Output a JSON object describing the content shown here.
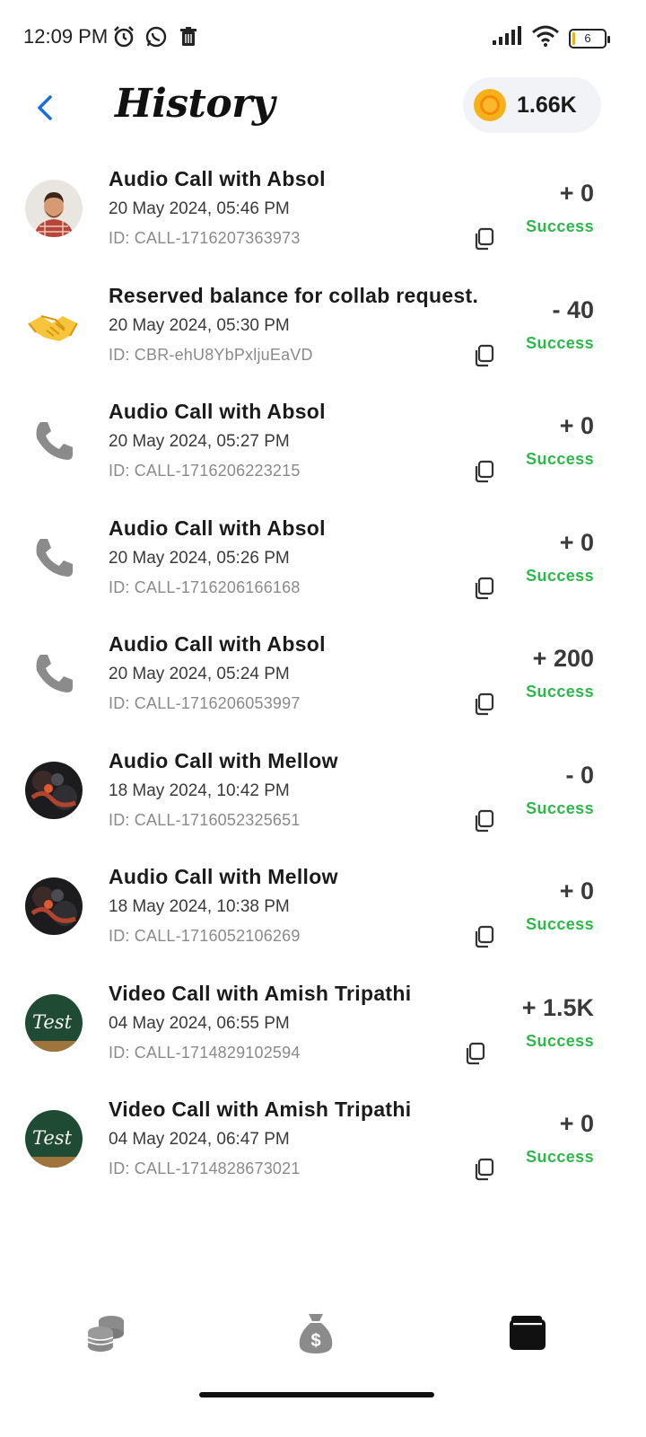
{
  "status_bar": {
    "time": "12:09 PM",
    "battery_level": "6",
    "icons": [
      "alarm-icon",
      "whatsapp-icon",
      "trash-icon",
      "signal-icon",
      "wifi-icon",
      "battery-icon"
    ]
  },
  "header": {
    "title": "History",
    "coin_balance": "1.66K",
    "accent_color": "#1a6fe0"
  },
  "transactions": [
    {
      "title": "Audio Call with Absol",
      "date": "20 May 2024, 05:46 PM",
      "id": "ID: CALL-1716207363973",
      "amount": "+ 0",
      "status": "Success",
      "avatar": "avatar-photo-man"
    },
    {
      "title": "Reserved balance for collab request.",
      "date": "20 May 2024, 05:30 PM",
      "id": "ID: CBR-ehU8YbPxljuEaVD",
      "amount": "- 40",
      "status": "Success",
      "avatar": "handshake-icon"
    },
    {
      "title": "Audio Call with Absol",
      "date": "20 May 2024, 05:27 PM",
      "id": "ID: CALL-1716206223215",
      "amount": "+ 0",
      "status": "Success",
      "avatar": "phone-icon"
    },
    {
      "title": "Audio Call with Absol",
      "date": "20 May 2024, 05:26 PM",
      "id": "ID: CALL-1716206166168",
      "amount": "+ 0",
      "status": "Success",
      "avatar": "phone-icon"
    },
    {
      "title": "Audio Call with Absol",
      "date": "20 May 2024, 05:24 PM",
      "id": "ID: CALL-1716206053997",
      "amount": "+ 200",
      "status": "Success",
      "avatar": "phone-icon"
    },
    {
      "title": "Audio Call with Mellow",
      "date": "18 May 2024, 10:42 PM",
      "id": "ID: CALL-1716052325651",
      "amount": "- 0",
      "status": "Success",
      "avatar": "avatar-photo-dark"
    },
    {
      "title": "Audio Call with Mellow",
      "date": "18 May 2024, 10:38 PM",
      "id": "ID: CALL-1716052106269",
      "amount": "+ 0",
      "status": "Success",
      "avatar": "avatar-photo-dark"
    },
    {
      "title": "Video Call with Amish Tripathi",
      "date": "04 May 2024, 06:55 PM",
      "id": "ID: CALL-1714829102594",
      "amount": "+ 1.5K",
      "status": "Success",
      "avatar": "avatar-test-board"
    },
    {
      "title": "Video Call with Amish Tripathi",
      "date": "04 May 2024, 06:47 PM",
      "id": "ID: CALL-1714828673021",
      "amount": "+ 0",
      "status": "Success",
      "avatar": "avatar-test-board"
    }
  ],
  "avatar_test_text": "Test",
  "status_color": "#2db84a",
  "bottom_nav": [
    {
      "icon": "coins-stack-icon",
      "active": false
    },
    {
      "icon": "money-bag-icon",
      "active": false
    },
    {
      "icon": "wallet-icon",
      "active": true
    }
  ]
}
